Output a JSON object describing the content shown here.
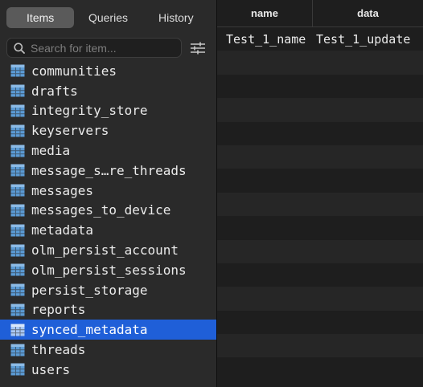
{
  "tabs": [
    {
      "label": "Items",
      "active": true
    },
    {
      "label": "Queries",
      "active": false
    },
    {
      "label": "History",
      "active": false
    }
  ],
  "search": {
    "placeholder": "Search for item..."
  },
  "sidebar": {
    "items": [
      {
        "label": "communities"
      },
      {
        "label": "drafts"
      },
      {
        "label": "integrity_store"
      },
      {
        "label": "keyservers"
      },
      {
        "label": "media"
      },
      {
        "label": "message_s…re_threads"
      },
      {
        "label": "messages"
      },
      {
        "label": "messages_to_device"
      },
      {
        "label": "metadata"
      },
      {
        "label": "olm_persist_account"
      },
      {
        "label": "olm_persist_sessions"
      },
      {
        "label": "persist_storage"
      },
      {
        "label": "reports"
      },
      {
        "label": "synced_metadata",
        "selected": true
      },
      {
        "label": "threads"
      },
      {
        "label": "users"
      }
    ]
  },
  "table": {
    "columns": [
      "name",
      "data"
    ],
    "rows": [
      [
        "Test_1_name",
        "Test_1_update"
      ]
    ],
    "empty_rows": 14
  },
  "colors": {
    "accent": "#1f5fd8",
    "table_icon": "#5b9bd5"
  },
  "icons": {
    "search": "search-icon",
    "filter": "sliders-icon",
    "table": "table-icon"
  }
}
